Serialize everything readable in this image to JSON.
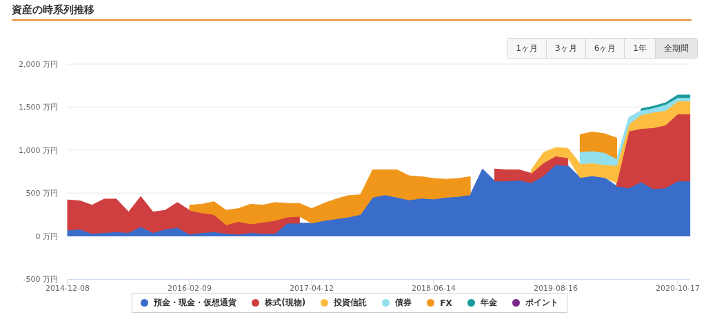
{
  "header": {
    "title": "資産の時系列推移"
  },
  "range_buttons": [
    {
      "label": "1ヶ月",
      "selected": false
    },
    {
      "label": "3ヶ月",
      "selected": false
    },
    {
      "label": "6ヶ月",
      "selected": false
    },
    {
      "label": "1年",
      "selected": false
    },
    {
      "label": "全期間",
      "selected": true
    }
  ],
  "chart": {
    "chart_data": {
      "type": "area",
      "stacked": true,
      "grid": true,
      "legend": true,
      "ylim": [
        -500,
        2000
      ],
      "categories": [
        "2014-12-08",
        null,
        null,
        null,
        null,
        null,
        null,
        null,
        null,
        null,
        "2016-02-09",
        null,
        null,
        null,
        null,
        null,
        null,
        null,
        null,
        null,
        "2017-04-12",
        null,
        null,
        null,
        null,
        null,
        null,
        null,
        null,
        null,
        "2018-06-14",
        null,
        null,
        null,
        null,
        null,
        null,
        null,
        null,
        null,
        "2019-08-16",
        null,
        null,
        null,
        null,
        null,
        null,
        null,
        null,
        null,
        "2020-10-17",
        null
      ],
      "yticks": [
        {
          "value": -500,
          "label": "-500 万円"
        },
        {
          "value": 0,
          "label": "0 万円"
        },
        {
          "value": 500,
          "label": "500 万円"
        },
        {
          "value": 1000,
          "label": "1,000 万円"
        },
        {
          "value": 1500,
          "label": "1,500 万円"
        },
        {
          "value": 2000,
          "label": "2,000 万円"
        }
      ],
      "series": [
        {
          "name": "預金・現金・仮想通貨",
          "color": "#3a6cc9",
          "values": [
            70,
            80,
            30,
            40,
            50,
            40,
            110,
            40,
            80,
            100,
            20,
            40,
            50,
            30,
            20,
            40,
            30,
            30,
            150,
            150,
            150,
            180,
            200,
            220,
            250,
            450,
            480,
            450,
            420,
            440,
            430,
            450,
            460,
            480,
            780,
            640,
            640,
            650,
            620,
            700,
            830,
            820,
            680,
            700,
            680,
            580,
            560,
            630,
            550,
            560,
            640,
            640
          ]
        },
        {
          "name": "株式(現物)",
          "color": "#d03f3f",
          "values": [
            350,
            330,
            330,
            390,
            380,
            240,
            350,
            240,
            220,
            290,
            280,
            230,
            200,
            100,
            150,
            100,
            130,
            150,
            70,
            80,
            null,
            null,
            null,
            null,
            null,
            null,
            null,
            null,
            null,
            null,
            null,
            null,
            null,
            null,
            null,
            140,
            130,
            120,
            110,
            150,
            100,
            90,
            null,
            null,
            null,
            40,
            660,
            620,
            710,
            730,
            780,
            780
          ]
        },
        {
          "name": "投資信託",
          "color": "#fdbd40",
          "values": [
            null,
            null,
            null,
            null,
            null,
            null,
            null,
            null,
            null,
            null,
            null,
            null,
            null,
            null,
            null,
            null,
            null,
            null,
            null,
            null,
            null,
            null,
            null,
            null,
            null,
            null,
            null,
            null,
            null,
            null,
            null,
            null,
            null,
            null,
            null,
            null,
            null,
            null,
            40,
            120,
            100,
            110,
            160,
            150,
            150,
            200,
            80,
            160,
            180,
            170,
            150,
            150
          ]
        },
        {
          "name": "債券",
          "color": "#92dfee",
          "values": [
            null,
            null,
            null,
            null,
            null,
            null,
            null,
            null,
            null,
            null,
            null,
            null,
            null,
            null,
            null,
            null,
            null,
            null,
            null,
            null,
            null,
            null,
            null,
            null,
            null,
            null,
            null,
            null,
            null,
            null,
            null,
            null,
            null,
            null,
            null,
            null,
            null,
            null,
            null,
            null,
            null,
            null,
            140,
            140,
            140,
            80,
            80,
            50,
            50,
            70,
            40,
            40
          ]
        },
        {
          "name": "FX",
          "color": "#f0961b",
          "values": [
            null,
            null,
            null,
            null,
            null,
            null,
            null,
            null,
            null,
            null,
            60,
            100,
            150,
            170,
            150,
            230,
            200,
            210,
            160,
            150,
            170,
            200,
            230,
            250,
            230,
            320,
            290,
            320,
            280,
            250,
            240,
            210,
            210,
            210,
            null,
            null,
            null,
            null,
            null,
            null,
            null,
            null,
            200,
            220,
            220,
            240,
            null,
            null,
            null,
            null,
            null,
            null
          ]
        },
        {
          "name": "年金",
          "color": "#1a9a9c",
          "values": [
            null,
            null,
            null,
            null,
            null,
            null,
            null,
            null,
            null,
            null,
            null,
            null,
            null,
            null,
            null,
            null,
            null,
            null,
            null,
            null,
            null,
            null,
            null,
            null,
            null,
            null,
            null,
            null,
            null,
            null,
            null,
            null,
            null,
            null,
            null,
            null,
            null,
            null,
            null,
            null,
            null,
            null,
            null,
            null,
            null,
            null,
            null,
            20,
            20,
            20,
            30,
            30
          ]
        },
        {
          "name": "ポイント",
          "color": "#7b2a8a",
          "values": [
            null,
            null,
            null,
            null,
            null,
            null,
            null,
            null,
            null,
            null,
            null,
            null,
            null,
            null,
            null,
            null,
            null,
            null,
            null,
            null,
            null,
            null,
            null,
            null,
            null,
            null,
            null,
            null,
            null,
            null,
            null,
            null,
            null,
            null,
            null,
            null,
            null,
            null,
            null,
            null,
            null,
            null,
            null,
            null,
            null,
            null,
            null,
            null,
            null,
            null,
            null,
            null
          ]
        }
      ]
    }
  }
}
